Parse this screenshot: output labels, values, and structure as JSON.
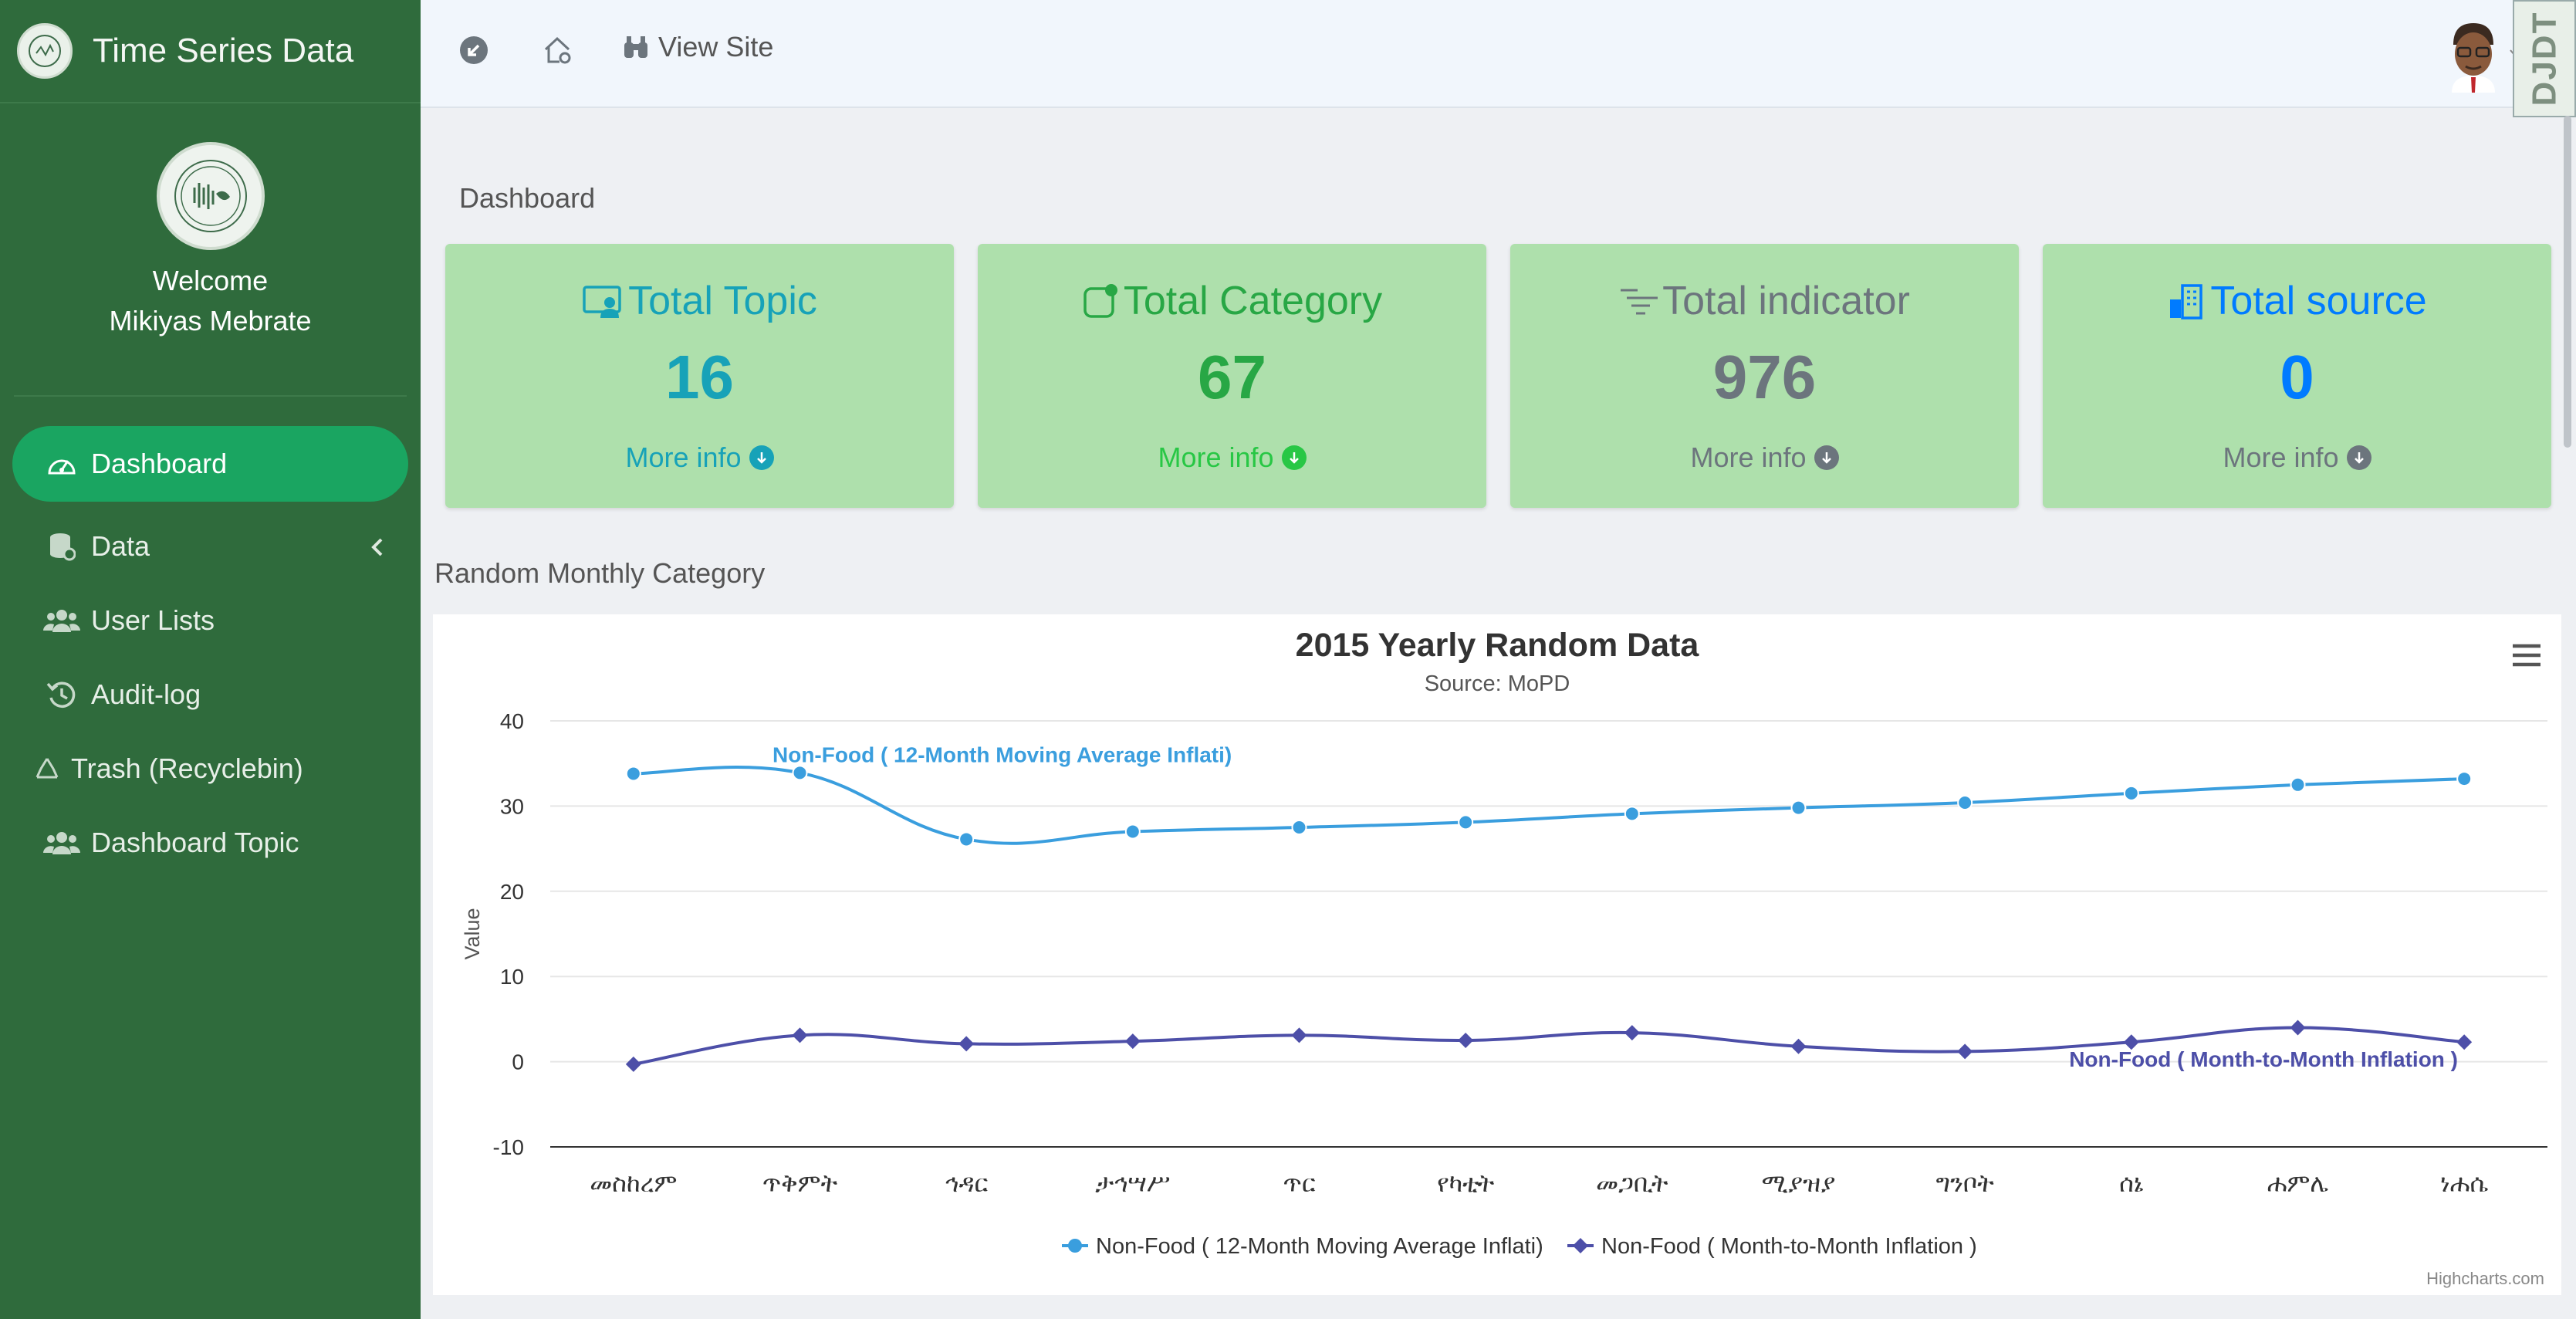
{
  "app": {
    "title": "Time Series Data"
  },
  "user": {
    "welcome": "Welcome",
    "name": "Mikiyas Mebrate"
  },
  "sidebar": {
    "items": [
      {
        "label": "Dashboard",
        "icon": "gauge-icon",
        "active": true
      },
      {
        "label": "Data",
        "icon": "database-icon",
        "has_submenu": true
      },
      {
        "label": "User Lists",
        "icon": "users-icon"
      },
      {
        "label": "Audit-log",
        "icon": "history-icon"
      },
      {
        "label": "Trash (Recyclebin)",
        "icon": "recycle-icon"
      },
      {
        "label": "Dashboard Topic",
        "icon": "users-icon"
      }
    ]
  },
  "topbar": {
    "view_site": "View Site",
    "debug_toolbar": "DJDT"
  },
  "page": {
    "title": "Dashboard",
    "section_title": "Random Monthly Category"
  },
  "cards": [
    {
      "title": "Total Topic",
      "value": "16",
      "more": "More info",
      "color": "#17a2b8",
      "icon": "monitor-user-icon"
    },
    {
      "title": "Total Category",
      "value": "67",
      "more": "More info",
      "color": "#28a745",
      "icon": "app-badge-icon"
    },
    {
      "title": "Total indicator",
      "value": "976",
      "more": "More info",
      "color": "#6c757d",
      "icon": "lines-icon"
    },
    {
      "title": "Total source",
      "value": "0",
      "more": "More info",
      "color": "#007bff",
      "icon": "buildings-icon"
    }
  ],
  "chart_data": {
    "type": "line",
    "title": "2015 Yearly Random Data",
    "subtitle": "Source: MoPD",
    "ylabel": "Value",
    "xlabel": "",
    "ylim": [
      -10,
      40
    ],
    "yticks": [
      40,
      30,
      20,
      10,
      0,
      -10
    ],
    "categories": [
      "መስከረም",
      "ጥቅምት",
      "ኅዳር",
      "ታኅሣሥ",
      "ጥር",
      "የካቲት",
      "መጋቢት",
      "ሚያዝያ",
      "ግንቦት",
      "ሰኔ",
      "ሐምሌ",
      "ነሐሴ"
    ],
    "series": [
      {
        "name": "Non-Food ( 12-Month Moving Average Inflati)",
        "color": "#3a9ede",
        "marker": "circle",
        "values": [
          33.8,
          33.9,
          26.1,
          27.0,
          27.5,
          28.1,
          29.1,
          29.8,
          30.4,
          31.5,
          32.5,
          33.2
        ]
      },
      {
        "name": "Non-Food ( Month-to-Month Inflation )",
        "color": "#4d4fa8",
        "marker": "diamond",
        "values": [
          -0.3,
          3.1,
          2.1,
          2.4,
          3.1,
          2.5,
          3.4,
          1.8,
          1.2,
          2.3,
          4.0,
          2.3
        ]
      }
    ],
    "annotations": [
      "Non-Food ( 12-Month Moving Average Inflati)",
      "Non-Food ( Month-to-Month Inflation )"
    ],
    "legend": "bottom",
    "grid": true,
    "credits": "Highcharts.com"
  }
}
